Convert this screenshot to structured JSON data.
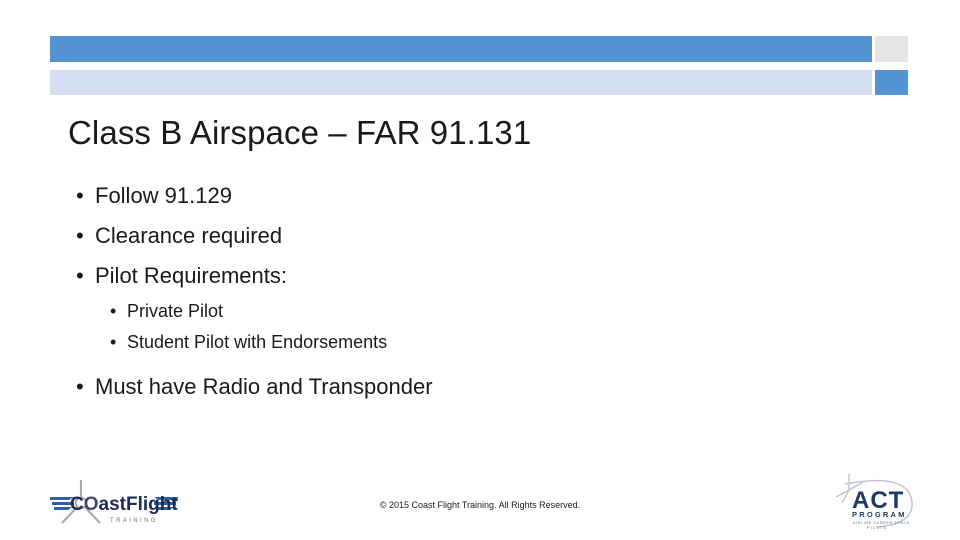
{
  "slide": {
    "title": "Class B Airspace – FAR 91.131",
    "bullets": [
      {
        "level": 1,
        "text": "Follow 91.129"
      },
      {
        "level": 1,
        "text": "Clearance required"
      },
      {
        "level": 1,
        "text": "Pilot Requirements:"
      },
      {
        "level": 2,
        "text": "Private Pilot"
      },
      {
        "level": 2,
        "text": "Student Pilot with Endorsements"
      },
      {
        "level": 1,
        "text": "Must have Radio and Transponder"
      }
    ],
    "bullet_glyph": "•"
  },
  "header": {
    "bar_color": "#5494d4",
    "bar_light_color": "#d3dff0",
    "accent_gray_color": "#e5e5e5"
  },
  "footer": {
    "copyright": "© 2015 Coast Flight Training. All Rights Reserved."
  },
  "logos": {
    "coast_flight": {
      "name": "coast-flight-training-logo",
      "wordmark_lead": "C",
      "wordmark_o": "O",
      "wordmark_rest": "astFlight",
      "subtitle": "T R A I N I N G",
      "text_color": "#1f2a55",
      "wing_color": "#2f5fa8",
      "prop_color": "#9a9a9a"
    },
    "act_program": {
      "name": "act-program-logo",
      "wordmark": "ACT",
      "subtitle": "PROGRAM",
      "tagline_line1": "AIRLINE CAREER TRACK",
      "tagline_line2": "PILOTS",
      "text_color": "#1f3a63",
      "swoosh_color": "#b9c3cf"
    }
  }
}
